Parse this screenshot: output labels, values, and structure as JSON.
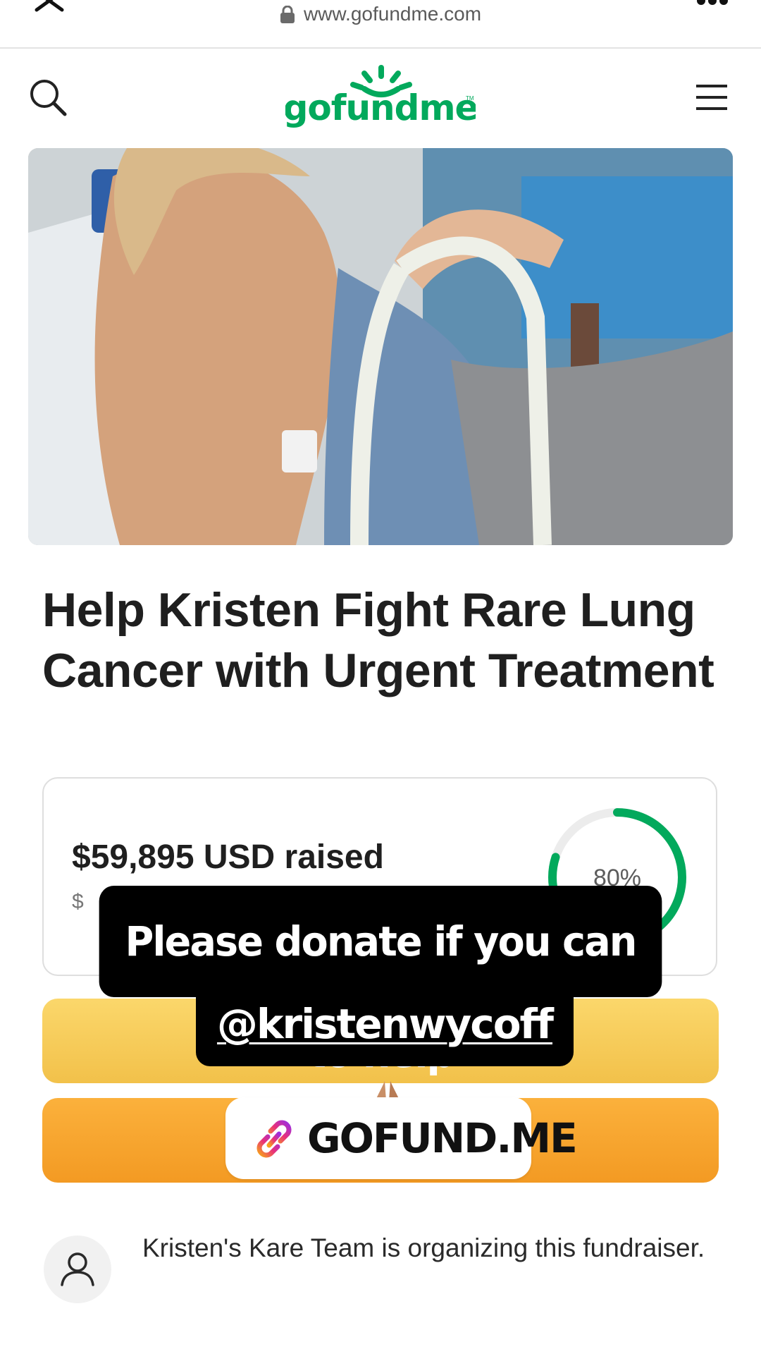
{
  "browser": {
    "url": "www.gofundme.com"
  },
  "header": {
    "logo_text": "gofundme",
    "logo_tm": "TM"
  },
  "campaign": {
    "title": "Help Kristen Fight Rare Lung Cancer with Urgent Treatment",
    "raised_text": "$59,895 USD raised",
    "goal_text_partial": "$",
    "progress_percent_text": "80%",
    "progress_value": 0.8
  },
  "organizer": {
    "text": "Kristen's Kare Team is organizing this fundraiser."
  },
  "story_overlay": {
    "line1": "Please donate if you can to help",
    "mention": "@kristenwycoff",
    "link_sticker_label": "GOFUND.ME"
  },
  "colors": {
    "brand_green": "#02a95c",
    "donate_yellow": "#f6c64f",
    "share_orange": "#f7a22c",
    "ring_track": "#ececec"
  },
  "icons": {
    "close": "close-icon",
    "lock": "lock-icon",
    "more": "more-icon",
    "search": "search-icon",
    "menu": "hamburger-menu-icon",
    "link": "link-icon",
    "user": "user-icon",
    "pray": "folded-hands-emoji"
  }
}
